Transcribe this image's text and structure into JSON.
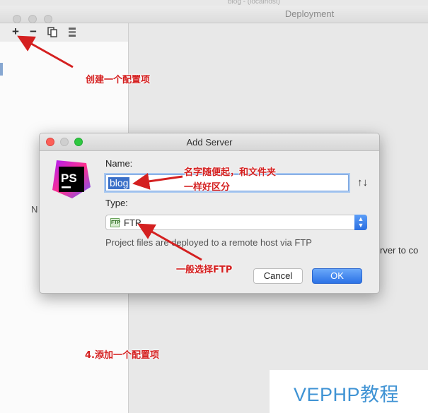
{
  "deployment_window": {
    "title": "Deployment",
    "top_strip_text": "blog - (localhost)",
    "left_toolbar": {
      "add_icon": "+",
      "remove_icon": "−",
      "copy_icon": "copy-icon",
      "move_icon": "move-icon"
    },
    "left_list_letter": "N",
    "right_partial_text": "rver to co"
  },
  "dialog": {
    "title": "Add Server",
    "logo_text": "PS",
    "name_label": "Name:",
    "name_value": "blog",
    "type_label": "Type:",
    "type_value": "FTP",
    "type_icon_text": "FTP",
    "description": "Project files are deployed to a remote host via FTP",
    "cancel_label": "Cancel",
    "ok_label": "OK",
    "sort_icon": "↑↓"
  },
  "annotations": {
    "create_config": "创建一个配置项",
    "name_hint_line1": "名字随便起，和文件夹",
    "name_hint_line2": "一样好区分",
    "ftp_hint": "一般选择FTP",
    "add_config": "4.添加一个配置项"
  },
  "watermark": "VEPHP教程",
  "colors": {
    "annotation_red": "#d42020",
    "accent_blue": "#2c72e6",
    "watermark_blue": "#3f93d4"
  }
}
